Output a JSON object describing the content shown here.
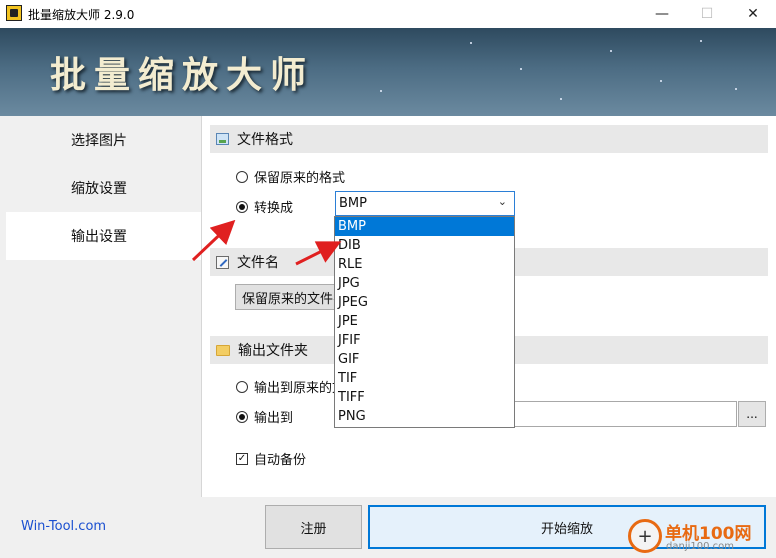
{
  "window": {
    "title": "批量缩放大师 2.9.0",
    "minimize_glyph": "—",
    "maximize_glyph": "☐",
    "close_glyph": "✕"
  },
  "banner": {
    "title": "批量缩放大师"
  },
  "sidebar": {
    "items": [
      {
        "label": "选择图片",
        "active": false
      },
      {
        "label": "缩放设置",
        "active": false
      },
      {
        "label": "输出设置",
        "active": true
      }
    ]
  },
  "format_section": {
    "title": "文件格式",
    "icon": "image-icon",
    "keep_original_label": "保留原来的格式",
    "convert_label": "转换成",
    "selected_format": "BMP",
    "format_options": [
      "BMP",
      "DIB",
      "RLE",
      "JPG",
      "JPEG",
      "JPE",
      "JFIF",
      "GIF",
      "TIF",
      "TIFF",
      "PNG"
    ],
    "highlighted_option": "BMP"
  },
  "filename_section": {
    "title": "文件名",
    "icon": "edit-icon",
    "dropdown_value": "保留原来的文件名"
  },
  "folder_section": {
    "title": "输出文件夹",
    "icon": "folder-icon",
    "original_folder_label": "输出到原来的文件夹",
    "output_to_label": "输出到",
    "output_path": "",
    "browse_label": "...",
    "auto_backup_label": "自动备份",
    "auto_backup_checked": true
  },
  "footer": {
    "site_link": "Win-Tool.com",
    "register_label": "注册",
    "start_label": "开始缩放"
  },
  "watermark": {
    "text": "单机100网",
    "sub": "danji100.com",
    "logo_glyph": "+"
  },
  "colors": {
    "accent": "#0078d7",
    "link": "#1a4fd0",
    "annotation_arrow": "#e02020",
    "watermark": "#e86a12"
  }
}
